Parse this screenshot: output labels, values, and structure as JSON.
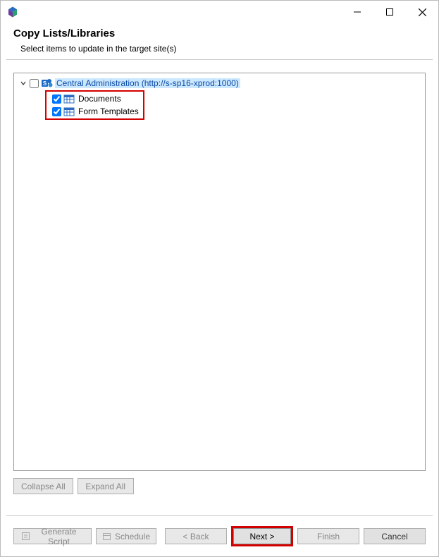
{
  "header": {
    "title": "Copy Lists/Libraries",
    "subtitle": "Select items to update in the target site(s)"
  },
  "tree": {
    "root": {
      "label": "Central Administration (http://s-sp16-xprod:1000)",
      "checked": false,
      "expanded": true
    },
    "children": [
      {
        "label": "Documents",
        "checked": true
      },
      {
        "label": "Form Templates",
        "checked": true
      }
    ]
  },
  "tree_buttons": {
    "collapse": "Collapse All",
    "expand": "Expand All"
  },
  "footer": {
    "generate_script": "Generate Script",
    "schedule": "Schedule",
    "back": "< Back",
    "next": "Next >",
    "finish": "Finish",
    "cancel": "Cancel"
  }
}
